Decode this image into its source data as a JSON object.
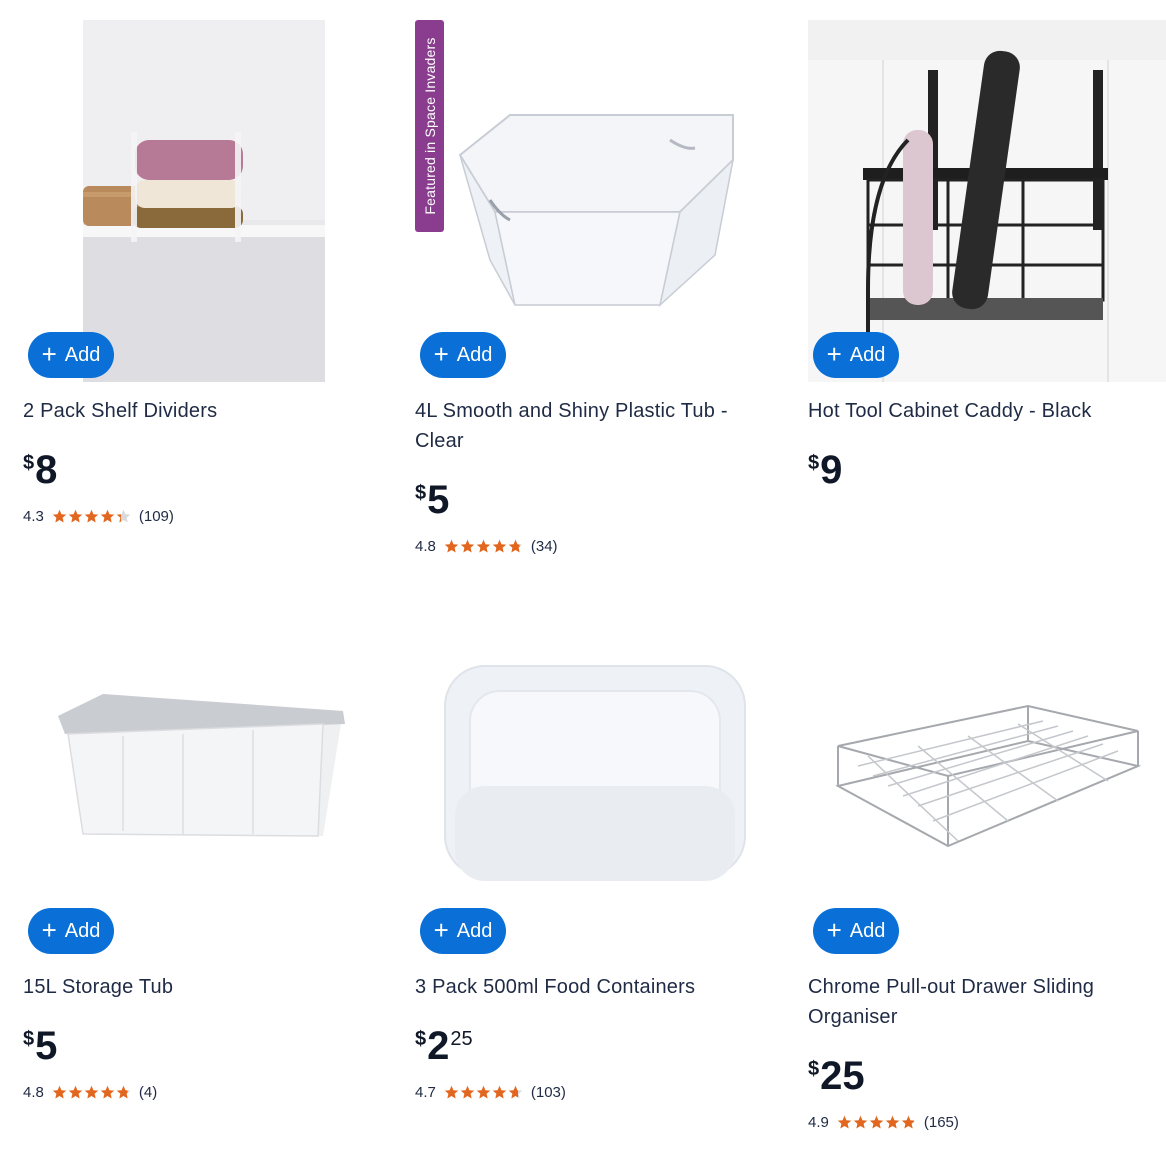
{
  "add_label": "Add",
  "products": [
    {
      "title": "2 Pack Shelf Dividers",
      "currency": "$",
      "price_int": "8",
      "price_cents": "",
      "rating": "4.3",
      "rating_value": 4.3,
      "reviews": "(109)"
    },
    {
      "title": "4L Smooth and Shiny Plastic Tub - Clear",
      "currency": "$",
      "price_int": "5",
      "price_cents": "",
      "rating": "4.8",
      "rating_value": 4.8,
      "reviews": "(34)",
      "badge": "Featured in Space Invaders"
    },
    {
      "title": "Hot Tool Cabinet Caddy - Black",
      "currency": "$",
      "price_int": "9",
      "price_cents": ""
    },
    {
      "title": "15L Storage Tub",
      "currency": "$",
      "price_int": "5",
      "price_cents": "",
      "rating": "4.8",
      "rating_value": 4.8,
      "reviews": "(4)"
    },
    {
      "title": "3 Pack 500ml Food Containers",
      "currency": "$",
      "price_int": "2",
      "price_cents": "25",
      "rating": "4.7",
      "rating_value": 4.7,
      "reviews": "(103)"
    },
    {
      "title": "Chrome Pull-out Drawer Sliding Organiser",
      "currency": "$",
      "price_int": "25",
      "price_cents": "",
      "rating": "4.9",
      "rating_value": 4.9,
      "reviews": "(165)"
    }
  ],
  "colors": {
    "accent": "#0a6fd6",
    "star": "#e2661e",
    "badge": "#8a3d8f"
  }
}
